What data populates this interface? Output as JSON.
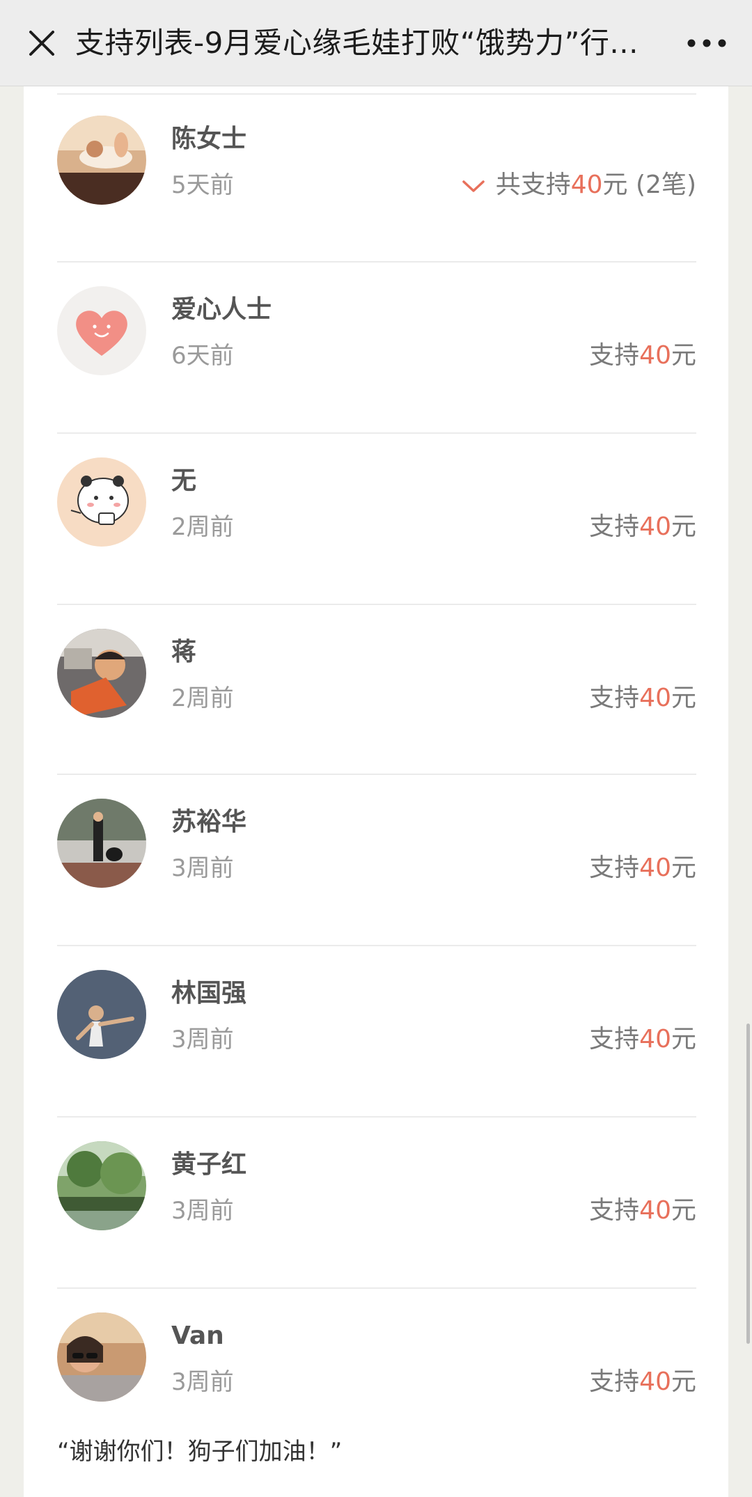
{
  "header": {
    "title": "支持列表-9月爱心缘毛娃打败“饿势力”行...",
    "close_icon": "close-icon",
    "more_icon": "more-icon"
  },
  "colors": {
    "accent": "#e8705b",
    "muted": "#9a9a9a",
    "name": "#555555"
  },
  "supporters": [
    {
      "name": "陈女士",
      "time": "5天前",
      "amount_prefix": "共支持",
      "amount_value": "40",
      "amount_suffix": "元 (2笔)",
      "expand_icon": "chevron-down-icon"
    },
    {
      "name": "爱心人士",
      "time": "6天前",
      "amount_prefix": "支持",
      "amount_value": "40",
      "amount_suffix": "元"
    },
    {
      "name": "无",
      "time": "2周前",
      "amount_prefix": "支持",
      "amount_value": "40",
      "amount_suffix": "元"
    },
    {
      "name": "蒋",
      "time": "2周前",
      "amount_prefix": "支持",
      "amount_value": "40",
      "amount_suffix": "元"
    },
    {
      "name": "苏裕华",
      "time": "3周前",
      "amount_prefix": "支持",
      "amount_value": "40",
      "amount_suffix": "元"
    },
    {
      "name": "林国强",
      "time": "3周前",
      "amount_prefix": "支持",
      "amount_value": "40",
      "amount_suffix": "元"
    },
    {
      "name": "黄子红",
      "time": "3周前",
      "amount_prefix": "支持",
      "amount_value": "40",
      "amount_suffix": "元"
    },
    {
      "name": "Van",
      "time": "3周前",
      "amount_prefix": "支持",
      "amount_value": "40",
      "amount_suffix": "元",
      "message": "“谢谢你们！狗子们加油！”"
    }
  ]
}
